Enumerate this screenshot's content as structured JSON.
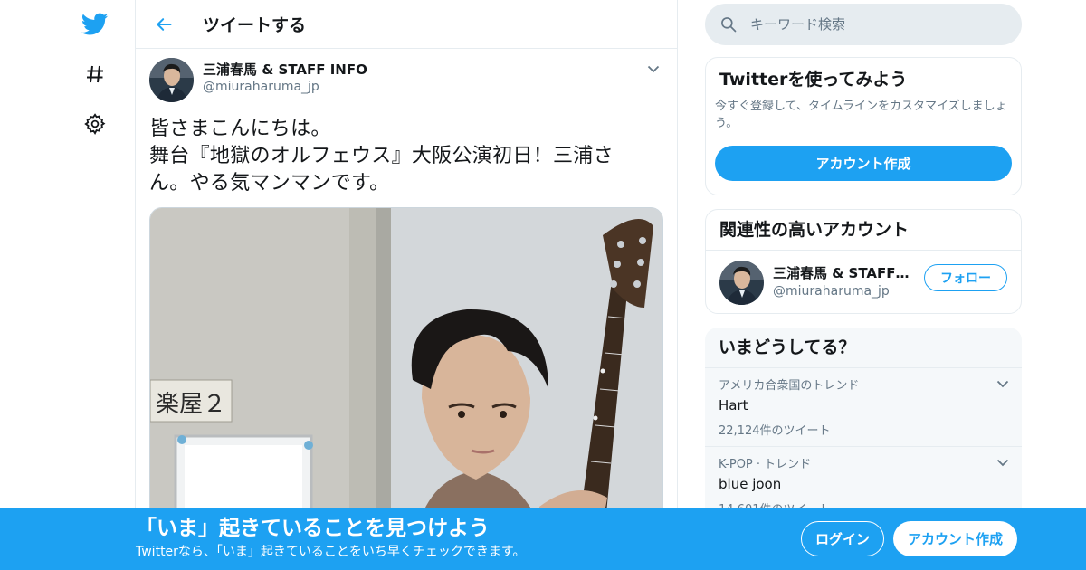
{
  "nav": {
    "items": [
      {
        "icon": "twitter-bird-icon"
      },
      {
        "icon": "hashtag-icon"
      },
      {
        "icon": "gear-icon"
      }
    ]
  },
  "header": {
    "title": "ツイートする"
  },
  "tweet": {
    "author_name": "三浦春馬 & STAFF INFO",
    "author_handle": "@miuraharuma_jp",
    "text_lines": [
      "皆さまこんにちは。",
      "舞台『地獄のオルフェウス』大阪公演初日！三浦さ",
      "ん。やる気マンマンです。"
    ],
    "media_sign": "楽屋２"
  },
  "search": {
    "placeholder": "キーワード検索"
  },
  "signup_card": {
    "title": "Twitterを使ってみよう",
    "description": "今すぐ登録して、タイムラインをカスタマイズしましょう。",
    "button": "アカウント作成"
  },
  "related_card": {
    "title": "関連性の高いアカウント",
    "account_name": "三浦春馬 & STAFF I...",
    "account_handle": "@miuraharuma_jp",
    "follow_button": "フォロー"
  },
  "trends_card": {
    "title": "いまどうしてる？",
    "items": [
      {
        "context": "アメリカ合衆国のトレンド",
        "name": "Hart",
        "count": "22,124件のツイート"
      },
      {
        "context": "K-POP · トレンド",
        "name": "blue joon",
        "count": "14,601件のツイート"
      }
    ]
  },
  "bottom_bar": {
    "title": "「いま」起きていることを見つけよう",
    "subtitle": "Twitterなら、「いま」起きていることをいち早くチェックできます。",
    "login_button": "ログイン",
    "signup_button": "アカウント作成"
  },
  "colors": {
    "accent": "#1da1f2",
    "secondary_text": "#657786",
    "border": "#e6ecf0"
  }
}
